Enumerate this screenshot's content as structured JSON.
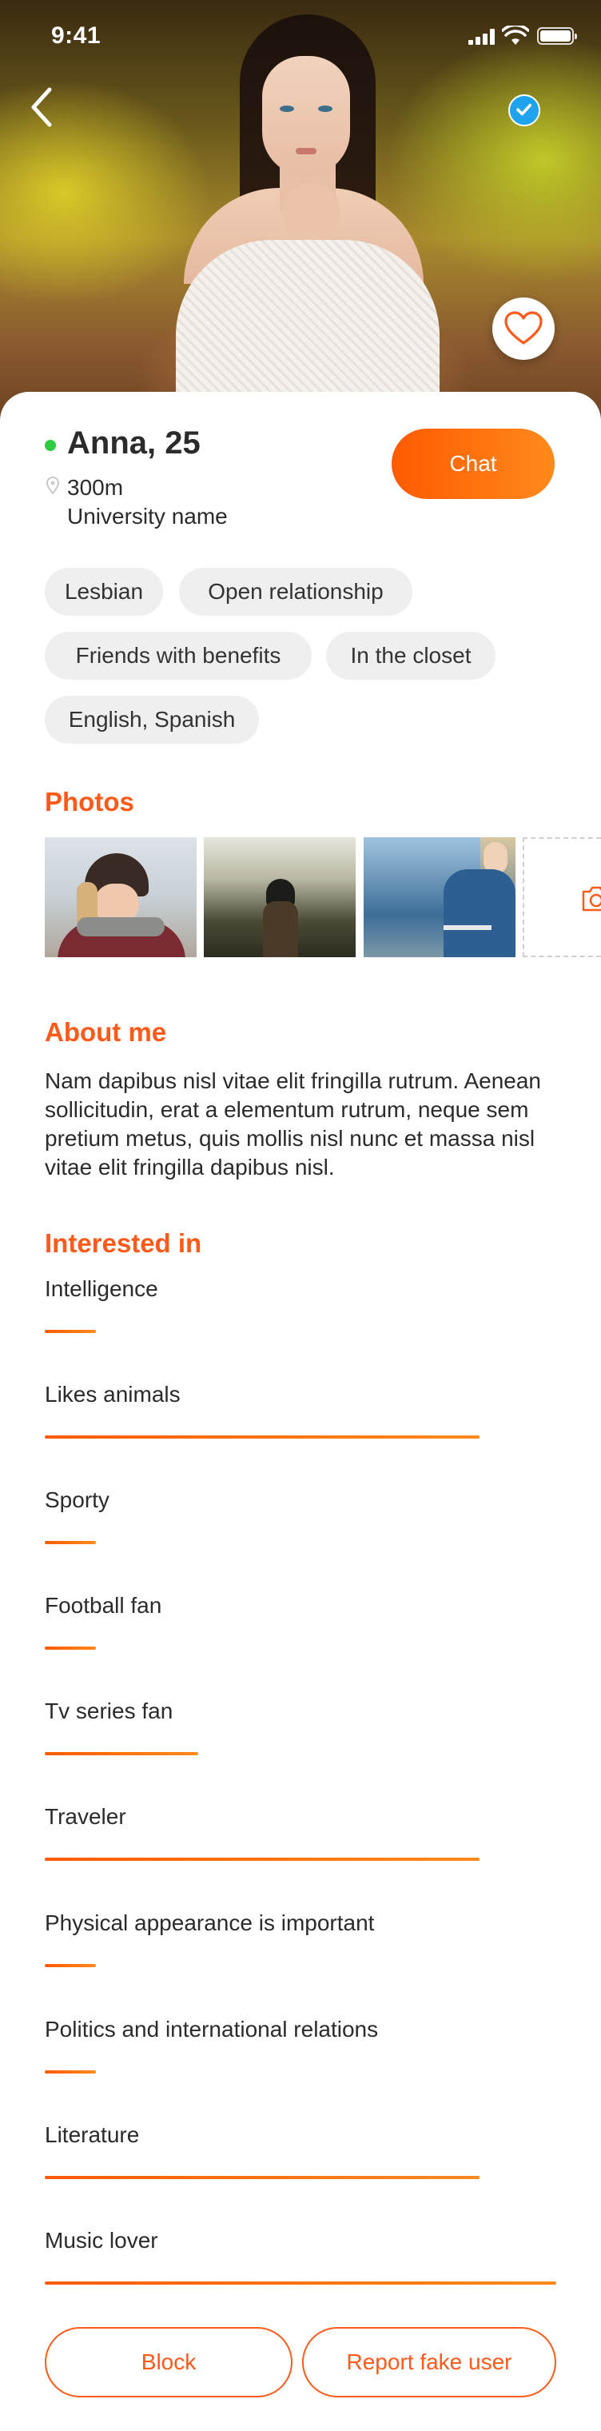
{
  "status_bar": {
    "time": "9:41"
  },
  "profile": {
    "name_age": "Anna, 25",
    "distance": "300m",
    "university": "University name",
    "chat_label": "Chat"
  },
  "tags": [
    "Lesbian",
    "Open relationship",
    "Friends with benefits",
    "In the closet",
    "English, Spanish"
  ],
  "photos": {
    "title": "Photos"
  },
  "about": {
    "title": "About me",
    "text": "Nam dapibus nisl vitae elit fringilla rutrum. Aenean sollicitudin, erat a elementum rutrum, neque sem pretium metus, quis mollis nisl nunc et massa nisl vitae elit fringilla dapibus nisl."
  },
  "interests": {
    "title": "Interested in",
    "items": [
      {
        "label": "Intelligence",
        "level": 0.1
      },
      {
        "label": "Likes animals",
        "level": 0.85
      },
      {
        "label": "Sporty",
        "level": 0.1
      },
      {
        "label": "Football fan",
        "level": 0.1
      },
      {
        "label": "Tv series fan",
        "level": 0.3
      },
      {
        "label": "Traveler",
        "level": 0.85
      },
      {
        "label": "Physical appearance is important",
        "level": 0.1
      },
      {
        "label": "Politics and international relations",
        "level": 0.1
      },
      {
        "label": "Literature",
        "level": 0.85
      },
      {
        "label": "Music lover",
        "level": 1.0
      }
    ]
  },
  "actions": {
    "block_label": "Block",
    "report_label": "Report fake user"
  },
  "colors": {
    "accent": "#ff5a1a",
    "online": "#2ecc40",
    "verified": "#1fa3ee"
  },
  "icons": [
    "back-arrow-icon",
    "verified-check-icon",
    "heart-icon",
    "location-pin-icon",
    "camera-icon",
    "signal-icon",
    "wifi-icon",
    "battery-icon"
  ]
}
